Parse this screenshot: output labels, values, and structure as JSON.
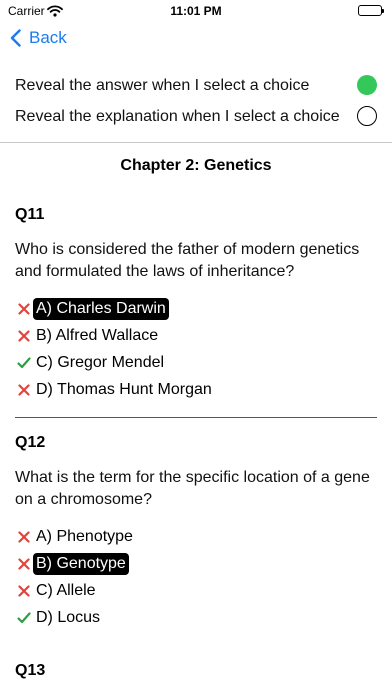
{
  "status": {
    "carrier": "Carrier",
    "time": "11:01 PM"
  },
  "nav": {
    "back_label": "Back"
  },
  "settings": [
    {
      "label": "Reveal the answer when I select a choice",
      "on": true
    },
    {
      "label": "Reveal the explanation when I select a choice",
      "on": false
    }
  ],
  "chapter_title": "Chapter 2: Genetics",
  "questions": [
    {
      "number": "Q11",
      "text": "Who is considered the father of modern genetics and formulated the laws of inheritance?",
      "choices": [
        {
          "label": "A) Charles Darwin",
          "correct": false,
          "selected": true
        },
        {
          "label": "B) Alfred Wallace",
          "correct": false,
          "selected": false
        },
        {
          "label": "C) Gregor Mendel",
          "correct": true,
          "selected": false
        },
        {
          "label": "D) Thomas Hunt Morgan",
          "correct": false,
          "selected": false
        }
      ]
    },
    {
      "number": "Q12",
      "text": "What is the term for the specific location of a gene on a chromosome?",
      "choices": [
        {
          "label": "A) Phenotype",
          "correct": false,
          "selected": false
        },
        {
          "label": "B) Genotype",
          "correct": false,
          "selected": true
        },
        {
          "label": "C) Allele",
          "correct": false,
          "selected": false
        },
        {
          "label": "D) Locus",
          "correct": true,
          "selected": false
        }
      ]
    },
    {
      "number": "Q13"
    }
  ],
  "colors": {
    "accent": "#1a7cf0",
    "toggle_on": "#34c759",
    "wrong": "#e0443c",
    "correct": "#2e9e44"
  }
}
